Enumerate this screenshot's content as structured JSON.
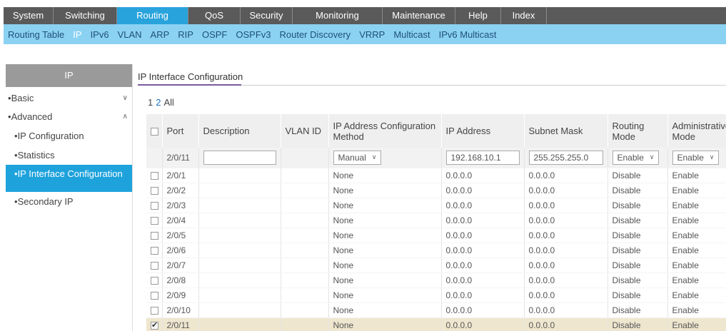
{
  "topnav": [
    "System",
    "Switching",
    "Routing",
    "QoS",
    "Security",
    "Monitoring",
    "Maintenance",
    "Help",
    "Index"
  ],
  "subnav": [
    "Routing Table",
    "IP",
    "IPv6",
    "VLAN",
    "ARP",
    "RIP",
    "OSPF",
    "OSPFv3",
    "Router Discovery",
    "VRRP",
    "Multicast",
    "IPv6 Multicast"
  ],
  "sidebar": {
    "header": "IP",
    "basic": "Basic",
    "advanced": "Advanced",
    "items": [
      "IP Configuration",
      "Statistics",
      "IP Interface Configuration",
      "Secondary IP"
    ]
  },
  "main": {
    "title": "IP Interface Configuration",
    "pages": [
      "1",
      "2",
      "All"
    ]
  },
  "table": {
    "headers": [
      "Port",
      "Description",
      "VLAN ID",
      "IP Address Configuration Method",
      "IP Address",
      "Subnet Mask",
      "Routing Mode",
      "Administrative Mode"
    ],
    "edit_row": {
      "port": "2/0/11",
      "description": "",
      "method": "Manual",
      "ip": "192.168.10.1",
      "mask": "255.255.255.0",
      "routing": "Enable",
      "admin": "Enable"
    },
    "rows": [
      {
        "port": "2/0/1",
        "method": "None",
        "ip": "0.0.0.0",
        "mask": "0.0.0.0",
        "routing": "Disable",
        "admin": "Enable",
        "checked": false
      },
      {
        "port": "2/0/2",
        "method": "None",
        "ip": "0.0.0.0",
        "mask": "0.0.0.0",
        "routing": "Disable",
        "admin": "Enable",
        "checked": false
      },
      {
        "port": "2/0/3",
        "method": "None",
        "ip": "0.0.0.0",
        "mask": "0.0.0.0",
        "routing": "Disable",
        "admin": "Enable",
        "checked": false
      },
      {
        "port": "2/0/4",
        "method": "None",
        "ip": "0.0.0.0",
        "mask": "0.0.0.0",
        "routing": "Disable",
        "admin": "Enable",
        "checked": false
      },
      {
        "port": "2/0/5",
        "method": "None",
        "ip": "0.0.0.0",
        "mask": "0.0.0.0",
        "routing": "Disable",
        "admin": "Enable",
        "checked": false
      },
      {
        "port": "2/0/6",
        "method": "None",
        "ip": "0.0.0.0",
        "mask": "0.0.0.0",
        "routing": "Disable",
        "admin": "Enable",
        "checked": false
      },
      {
        "port": "2/0/7",
        "method": "None",
        "ip": "0.0.0.0",
        "mask": "0.0.0.0",
        "routing": "Disable",
        "admin": "Enable",
        "checked": false
      },
      {
        "port": "2/0/8",
        "method": "None",
        "ip": "0.0.0.0",
        "mask": "0.0.0.0",
        "routing": "Disable",
        "admin": "Enable",
        "checked": false
      },
      {
        "port": "2/0/9",
        "method": "None",
        "ip": "0.0.0.0",
        "mask": "0.0.0.0",
        "routing": "Disable",
        "admin": "Enable",
        "checked": false
      },
      {
        "port": "2/0/10",
        "method": "None",
        "ip": "0.0.0.0",
        "mask": "0.0.0.0",
        "routing": "Disable",
        "admin": "Enable",
        "checked": false
      },
      {
        "port": "2/0/11",
        "method": "None",
        "ip": "0.0.0.0",
        "mask": "0.0.0.0",
        "routing": "Disable",
        "admin": "Enable",
        "checked": true
      }
    ]
  }
}
